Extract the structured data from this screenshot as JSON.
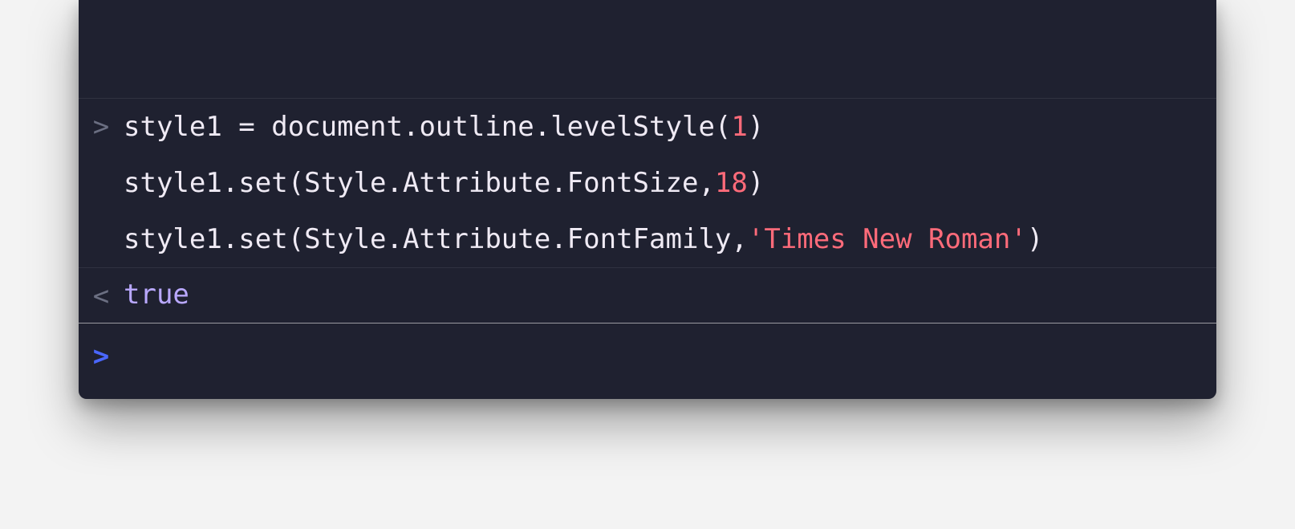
{
  "prompts": {
    "input": ">",
    "output": "<",
    "active": ">"
  },
  "input": {
    "line1": {
      "a": "style1 = document.outline.levelStyle(",
      "num": "1",
      "b": ")"
    },
    "line2": {
      "a": "style1.set(Style.Attribute.FontSize,",
      "num": "18",
      "b": ")"
    },
    "line3": {
      "a": "style1.set(Style.Attribute.FontFamily,",
      "str": "'Times New Roman'",
      "b": ")"
    }
  },
  "output": {
    "value": "true"
  }
}
